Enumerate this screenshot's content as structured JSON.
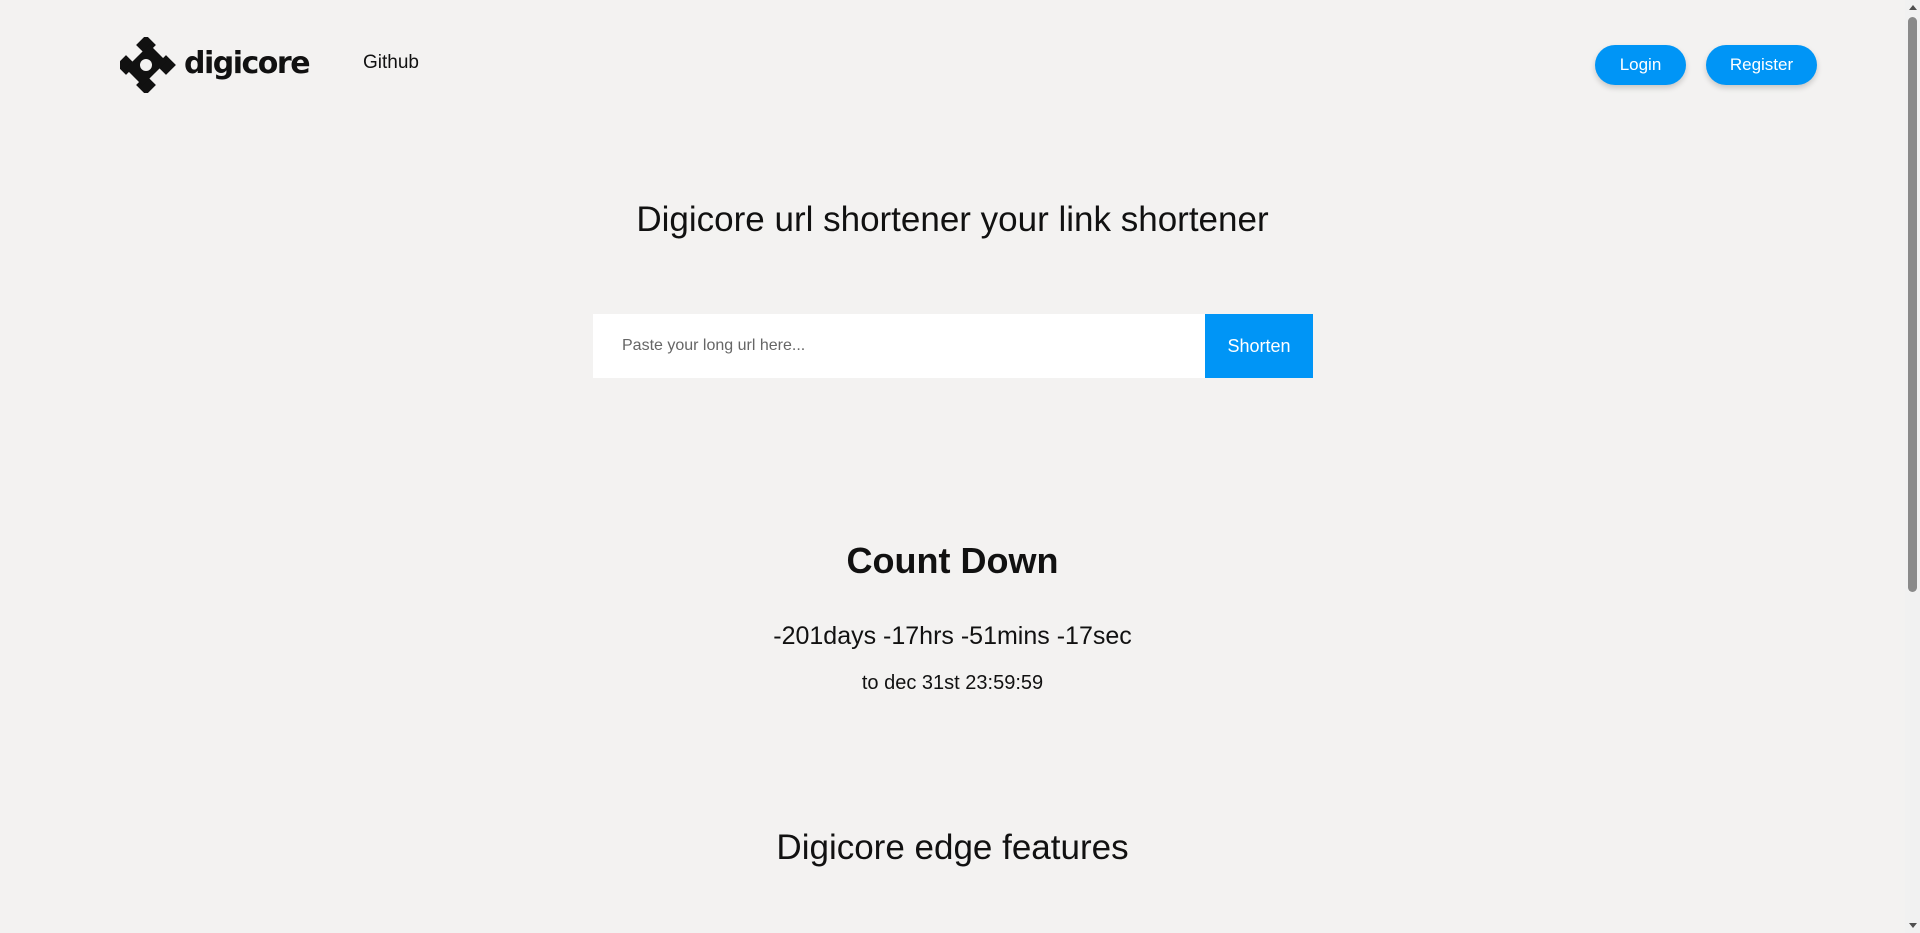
{
  "header": {
    "logo_text": "digicore",
    "nav_github": "Github",
    "login_label": "Login",
    "register_label": "Register"
  },
  "hero": {
    "title": "Digicore url shortener your link shortener",
    "input_placeholder": "Paste your long url here...",
    "input_value": "",
    "shorten_label": "Shorten"
  },
  "countdown": {
    "title": "Count Down",
    "value": "-201days -17hrs -51mins -17sec",
    "target": "to dec 31st 23:59:59"
  },
  "features": {
    "title": "Digicore edge features"
  },
  "colors": {
    "background": "#f3f2f1",
    "accent": "#0095f6",
    "text": "#111111"
  },
  "icons": {
    "logo": "digicore-logo-icon",
    "scroll_up": "chevron-up-icon",
    "scroll_down": "chevron-down-icon"
  }
}
